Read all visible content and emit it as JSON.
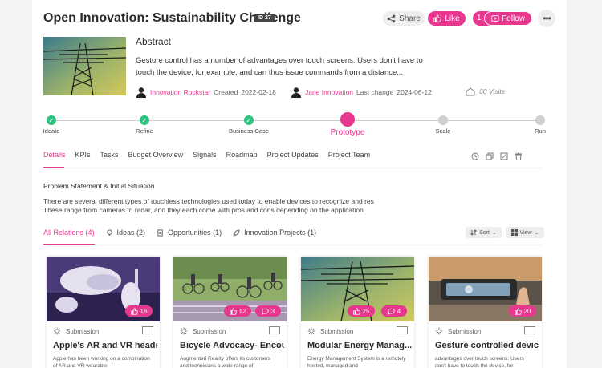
{
  "header": {
    "title": "Open Innovation: Sustainability Challenge",
    "id_badge": "ID 27",
    "share_label": "Share",
    "like_label": "Like",
    "follow_count": "1",
    "follow_label": "Follow",
    "more_icon": "ellipsis-icon"
  },
  "abstract": {
    "heading": "Abstract",
    "text": "Gesture control has a number of advantages over touch screens: Users don't have to touch the device, for example, and can thus issue commands from a distance...",
    "author": "Innovation Rockstar",
    "created_label": "Created",
    "created_date": "2022-02-18",
    "editor": "Jane Innovation",
    "changed_label": "Last change",
    "changed_date": "2024-06-12",
    "visits": "60 Visits"
  },
  "stepper": {
    "steps": [
      {
        "label": "Ideate",
        "state": "done"
      },
      {
        "label": "Refine",
        "state": "done"
      },
      {
        "label": "Business Case",
        "state": "done"
      },
      {
        "label": "Prototype",
        "state": "current"
      },
      {
        "label": "Scale",
        "state": "todo"
      },
      {
        "label": "Run",
        "state": "todo"
      }
    ]
  },
  "tabs": [
    "Details",
    "KPIs",
    "Tasks",
    "Budget Overview",
    "Signals",
    "Roadmap",
    "Project Updates",
    "Project Team"
  ],
  "details": {
    "section_title": "Problem Statement & Initial Situation",
    "line1": "There are several different types of touchless technologies used today to enable devices to recognize and res",
    "line2": "These range from cameras to radar, and they each come with pros and cons depending on the application."
  },
  "relations": {
    "tabs": [
      "All Relations (4)",
      "Ideas (2)",
      "Opportunities (1)",
      "Innovation Projects (1)"
    ],
    "sort_label": "Sort",
    "view_label": "View"
  },
  "cards": [
    {
      "likes": "16",
      "comments": "",
      "type": "Submission",
      "title": "Apple's AR and VR heads...",
      "desc": "Apple has been working on a combination of AR and VR wearable"
    },
    {
      "likes": "12",
      "comments": "3",
      "type": "Submission",
      "title": "Bicycle Advocacy- Encou...",
      "desc": "Augmented Reality offers its customers and technicians a wide range of"
    },
    {
      "likes": "25",
      "comments": "4",
      "type": "Submission",
      "title": "Modular Energy Manag...",
      "desc": "Energy Management System is a remotely hosted, managed and"
    },
    {
      "likes": "20",
      "comments": "",
      "type": "Submission",
      "title": "Gesture controlled devices",
      "desc": "advantages over touch screens: Users don't have to touch the device, for"
    }
  ],
  "colors": {
    "accent": "#e8378e",
    "done": "#2ec27e",
    "todo": "#cfcfcf"
  }
}
